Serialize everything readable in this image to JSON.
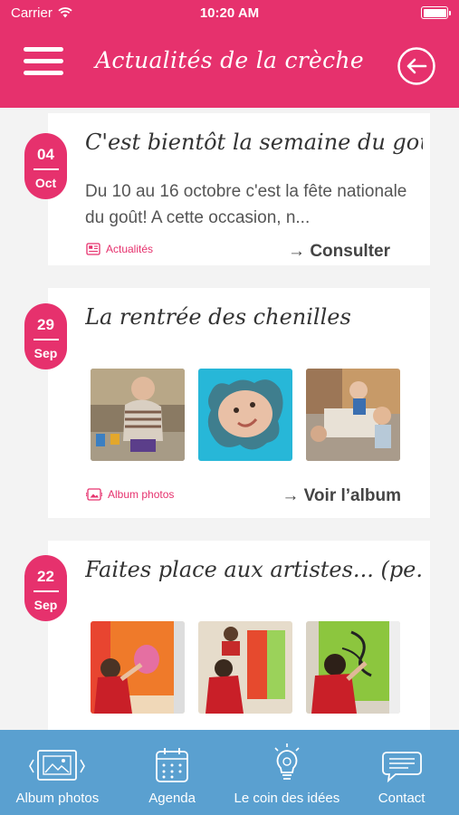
{
  "status": {
    "carrier": "Carrier",
    "time": "10:20 AM"
  },
  "header": {
    "title": "Actualités de la crèche"
  },
  "posts": [
    {
      "day": "04",
      "month": "Oct",
      "title": "C'est bientôt la semaine du goût",
      "excerpt": "Du 10 au 16 octobre c'est la fête nationale du goût! A cette occasion, n...",
      "category": "Actualités",
      "action": "→ Consulter"
    },
    {
      "day": "29",
      "month": "Sep",
      "title": "La rentrée des chenilles",
      "category": "Album photos",
      "action": "→ Voir l’album"
    },
    {
      "day": "22",
      "month": "Sep",
      "title": "Faites place aux artistes... (pe..."
    }
  ],
  "tabs": [
    {
      "label": "Album photos"
    },
    {
      "label": "Agenda"
    },
    {
      "label": "Le coin des idées"
    },
    {
      "label": "Contact"
    }
  ],
  "colors": {
    "brand": "#e6316d",
    "tabbar": "#5aa0d0"
  }
}
